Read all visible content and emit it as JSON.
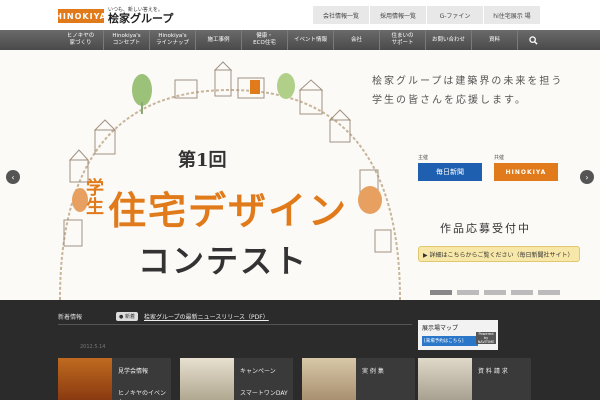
{
  "header": {
    "logo_mark": "HINOKIYA",
    "logo_tagline": "いつも、新しい答えを。",
    "logo_name": "桧家グループ",
    "top_links": [
      "会社情報一覧",
      "採用情報一覧",
      "G-ファイン",
      "hi住宅展示 場"
    ]
  },
  "nav": {
    "items": [
      "ヒノキヤの\n家づくり",
      "Hinokiya's\nコンセプト",
      "Hinokiya's\nラインナップ",
      "施工事例",
      "健康・\nECO住宅",
      "イベント情報",
      "会社",
      "住まいの\nサポート",
      "お問い合わせ",
      "資料"
    ],
    "search_icon": "search-icon"
  },
  "hero": {
    "slogan_line1": "桧家グループは建築界の未来を担う",
    "slogan_line2": "学生の皆さんを応援します。",
    "sponsor_label": "主催",
    "sponsor_name": "毎日新聞",
    "cosponsor_label": "共催",
    "cosponsor_name": "HINOKIYA",
    "contest_number": "第1回",
    "contest_prefix": "学生",
    "contest_title_1": "住宅デザイン",
    "contest_title_2": "コンテスト",
    "accept_text": "作品応募受付中",
    "detail_button": "▶ 詳細はこちらからご覧ください（毎日新聞社サイト）",
    "prev_arrow": "‹",
    "next_arrow": "›",
    "slide_count": 5,
    "active_slide": 1
  },
  "news": {
    "label": "新着情報",
    "badge": "● 新着",
    "text": "桧家グループの最新ニュースリリース（PDF）",
    "date": "2012.5.14"
  },
  "cards": [
    {
      "label": "見学会情報",
      "sub": "ヒノキヤのイベント"
    },
    {
      "label": "キャンペーン",
      "sub": "スマートワンDAY"
    },
    {
      "label": "実 例 集",
      "sub": ""
    },
    {
      "label": "資 料 請 求",
      "sub": ""
    }
  ],
  "map": {
    "title": "展示場マップ",
    "sub": "[来場予約はこちら]",
    "powered": "Powered by NAVITIME"
  },
  "colors": {
    "brand_orange": "#e07a1a",
    "nav_gray": "#555555",
    "mainichi_blue": "#1f5fb0"
  }
}
